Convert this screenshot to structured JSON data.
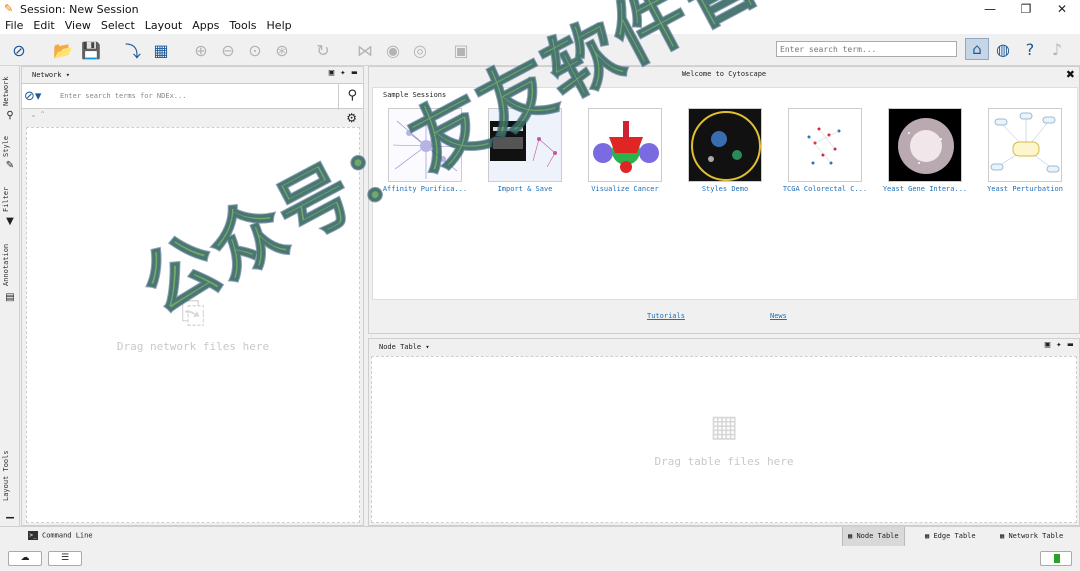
{
  "window": {
    "title": "Session: New Session",
    "controls": [
      "—",
      "❐",
      "✕"
    ]
  },
  "menu": [
    "File",
    "Edit",
    "View",
    "Select",
    "Layout",
    "Apps",
    "Tools",
    "Help"
  ],
  "toolbar": {
    "search_placeholder": "Enter search term..."
  },
  "side_tabs": [
    "Network",
    "Style",
    "Filter",
    "Annotation",
    "Layout Tools"
  ],
  "network_panel": {
    "header": "Network ▾",
    "search_placeholder": "Enter search terms for NDEx...",
    "drop_text": "Drag network files here"
  },
  "welcome": {
    "title": "Welcome to Cytoscape",
    "sample_label": "Sample Sessions",
    "sessions": [
      "Affinity Purifica...",
      "Import & Save",
      "Visualize Cancer",
      "Styles Demo",
      "TCGA Colorectal C...",
      "Yeast Gene Intera...",
      "Yeast Perturbation"
    ],
    "links": [
      "Tutorials",
      "News"
    ]
  },
  "node_panel": {
    "header": "Node Table ▾",
    "drop_text": "Drag table files here"
  },
  "status": {
    "command_line": "Command Line",
    "tabs": [
      "Node Table",
      "Edge Table",
      "Network Table"
    ]
  },
  "watermark": "公众号：友友软件管家",
  "colors": {
    "accent": "#1a5a96",
    "link": "#1e6fb8",
    "watermark": "#56944a"
  }
}
